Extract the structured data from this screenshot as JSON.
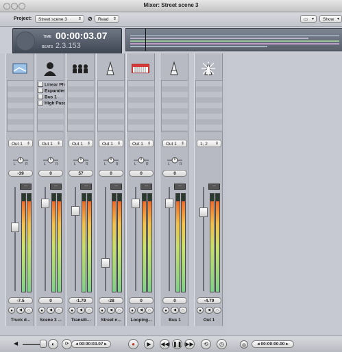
{
  "window": {
    "title": "Mixer: Street scene 3"
  },
  "toolbar": {
    "project_label": "Project:",
    "project_value": "Street scene 3",
    "automation_value": "Read",
    "show_label": "Show"
  },
  "transport": {
    "time_label": "TIME",
    "time_value": "00:00:03.07",
    "beats_label": "BEATS",
    "beats_value": "2.3.153"
  },
  "strips": [
    {
      "name": "Truck d...",
      "icon": "image-icon",
      "output": "Out 1",
      "pan": "-39",
      "volume": "-7.5",
      "plugins": [],
      "fader_level": 0.62,
      "meter_level": 0.92
    },
    {
      "name": "Scene 3 ...",
      "icon": "person-icon",
      "output": "Out 1",
      "pan": "0",
      "volume": "0",
      "plugins": [
        "Linear Ph",
        "Expander",
        "Bus 1",
        "High Pass"
      ],
      "fader_level": 0.88,
      "meter_level": 0.92
    },
    {
      "name": "Transiti...",
      "icon": "group-icon",
      "output": "Out 1",
      "pan": "57",
      "volume": "-1.79",
      "plugins": [],
      "fader_level": 0.8,
      "meter_level": 0.92
    },
    {
      "name": "Street n...",
      "icon": "mixer-sound-icon",
      "output": "Out 1",
      "pan": "0",
      "volume": "-28",
      "plugins": [],
      "fader_level": 0.25,
      "meter_level": 0.92
    },
    {
      "name": "Looping...",
      "icon": "keyboard-icon",
      "output": "Out 1",
      "pan": "0",
      "volume": "0",
      "plugins": [],
      "fader_level": 0.88,
      "meter_level": 0.92
    },
    {
      "name": "Bus 1",
      "icon": "mixer-sound-icon",
      "output": "Out 1",
      "pan": "0",
      "volume": "0",
      "plugins": [],
      "fader_level": 0.88,
      "meter_level": 0.92
    },
    {
      "name": "Out 1",
      "icon": "output-icon",
      "output": "1, 2",
      "pan": "",
      "volume": "-4.79",
      "plugins": [],
      "fader_level": 0.78,
      "meter_level": 0.92
    }
  ],
  "bottom": {
    "playhead_time": "00:00:03.07",
    "end_time": "00:00:00.00"
  },
  "colors": {
    "meter_low": "#7fd08a",
    "meter_high": "#f06a2a",
    "record": "#c0392b"
  }
}
